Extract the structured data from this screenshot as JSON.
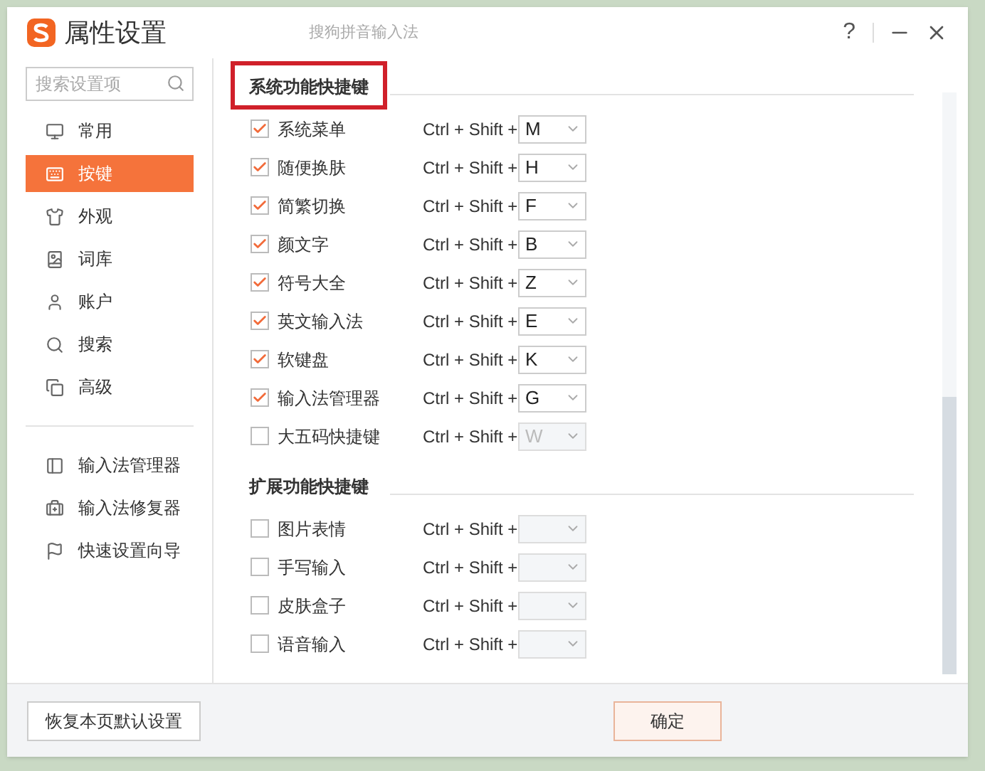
{
  "window": {
    "title": "属性设置",
    "subtitle": "搜狗拼音输入法",
    "controls": [
      "?"
    ]
  },
  "sidebar": {
    "search": {
      "placeholder": "搜索设置项"
    },
    "items": [
      {
        "label": "常用",
        "selected": false
      },
      {
        "label": "按键",
        "selected": true
      },
      {
        "label": "外观",
        "selected": false
      },
      {
        "label": "词库",
        "selected": false
      },
      {
        "label": "账户",
        "selected": false
      },
      {
        "label": "搜索",
        "selected": false
      },
      {
        "label": "高级",
        "selected": false
      }
    ],
    "tools": [
      "输入法管理器",
      "输入法修复器",
      "快速设置向导"
    ],
    "reset_button": "恢复本页默认设置"
  },
  "sections": [
    {
      "title": "系统功能快捷键",
      "highlighted": true,
      "rows": [
        {
          "label": "系统菜单",
          "checked": true,
          "modifier": "Ctrl + Shift +",
          "key": "M"
        },
        {
          "label": "随便换肤",
          "checked": true,
          "modifier": "Ctrl + Shift +",
          "key": "H"
        },
        {
          "label": "简繁切换",
          "checked": true,
          "modifier": "Ctrl + Shift +",
          "key": "F"
        },
        {
          "label": "颜文字",
          "checked": true,
          "modifier": "Ctrl + Shift +",
          "key": "B"
        },
        {
          "label": "符号大全",
          "checked": true,
          "modifier": "Ctrl + Shift +",
          "key": "Z"
        },
        {
          "label": "英文输入法",
          "checked": true,
          "modifier": "Ctrl + Shift +",
          "key": "E"
        },
        {
          "label": "软键盘",
          "checked": true,
          "modifier": "Ctrl + Shift +",
          "key": "K"
        },
        {
          "label": "输入法管理器",
          "checked": true,
          "modifier": "Ctrl + Shift +",
          "key": "G"
        },
        {
          "label": "大五码快捷键",
          "checked": false,
          "modifier": "Ctrl + Shift +",
          "key": "W"
        }
      ]
    },
    {
      "title": "扩展功能快捷键",
      "highlighted": false,
      "rows": [
        {
          "label": "图片表情",
          "checked": false,
          "modifier": "Ctrl + Shift +"
        },
        {
          "label": "手写输入",
          "checked": false,
          "modifier": "Ctrl + Shift +"
        },
        {
          "label": "皮肤盒子",
          "checked": false,
          "modifier": "Ctrl + Shift +"
        },
        {
          "label": "语音输入",
          "checked": false,
          "modifier": "Ctrl + Shift +"
        }
      ]
    }
  ],
  "footer": {
    "buttons": [
      "确定"
    ]
  }
}
